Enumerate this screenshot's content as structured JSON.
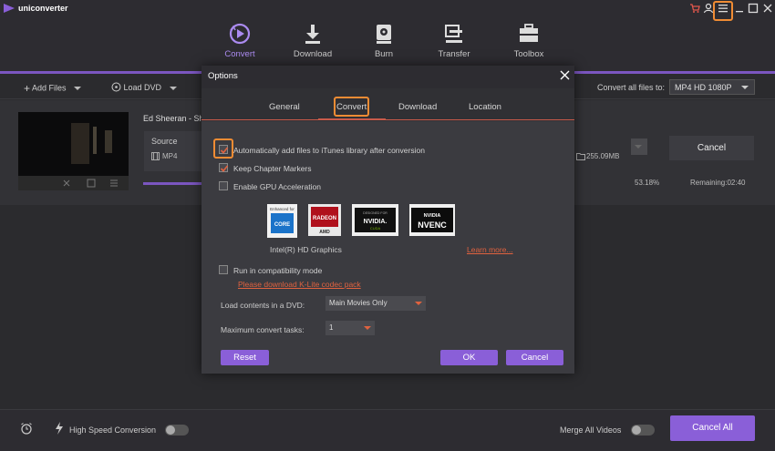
{
  "app": {
    "name": "uniconverter"
  },
  "nav": {
    "tabs": [
      {
        "label": "Convert",
        "icon": "convert-icon",
        "active": true
      },
      {
        "label": "Download",
        "icon": "download-icon"
      },
      {
        "label": "Burn",
        "icon": "burn-icon"
      },
      {
        "label": "Transfer",
        "icon": "transfer-icon"
      },
      {
        "label": "Toolbox",
        "icon": "toolbox-icon"
      }
    ]
  },
  "toolbar": {
    "add_files": "Add Files",
    "load_dvd": "Load DVD",
    "convert_all_label": "Convert all files to:",
    "format_value": "MP4 HD 1080P"
  },
  "file": {
    "title": "Ed Sheeran - Sha",
    "source_label": "Source",
    "source_format": "MP4",
    "size": "255.09MB",
    "percent": "53.18%",
    "progress_fraction": 0.5318,
    "remaining": "Remaining:02:40",
    "cancel_label": "Cancel"
  },
  "bottom": {
    "high_speed_label": "High Speed Conversion",
    "merge_label": "Merge All Videos",
    "cancel_all_label": "Cancel All"
  },
  "dialog": {
    "title": "Options",
    "tabs": [
      "General",
      "Convert",
      "Download",
      "Location"
    ],
    "active_tab": "Convert",
    "options": [
      {
        "label": "Automatically add files to iTunes library after conversion",
        "checked": true
      },
      {
        "label": "Keep Chapter Markers",
        "checked": true
      },
      {
        "label": "Enable GPU Acceleration",
        "checked": false
      }
    ],
    "gpu_logos": {
      "intel_top": "Enhanced for",
      "intel_core": "CORE",
      "amd_text": "RADEON",
      "amd_sub": "AMD",
      "cuda_top": "DESIGNED FOR",
      "cuda_brand": "NVIDIA.",
      "cuda_sub": "CUDA",
      "nvenc_brand": "NVIDIA",
      "nvenc_text": "NVENC"
    },
    "gpu_caption": "Intel(R) HD Graphics",
    "learn_more": "Learn more...",
    "compat_label": "Run in compatibility mode",
    "compat_checked": false,
    "klite_link": "Please download K-Lite codec pack",
    "dvd_label": "Load contents in a DVD:",
    "dvd_value": "Main Movies Only",
    "tasks_label": "Maximum convert tasks:",
    "tasks_value": "1",
    "reset_label": "Reset",
    "ok_label": "OK",
    "cancel_label": "Cancel"
  },
  "colors": {
    "accent": "#8a5fd8",
    "highlight": "#f08c34",
    "link": "#e0623f"
  }
}
